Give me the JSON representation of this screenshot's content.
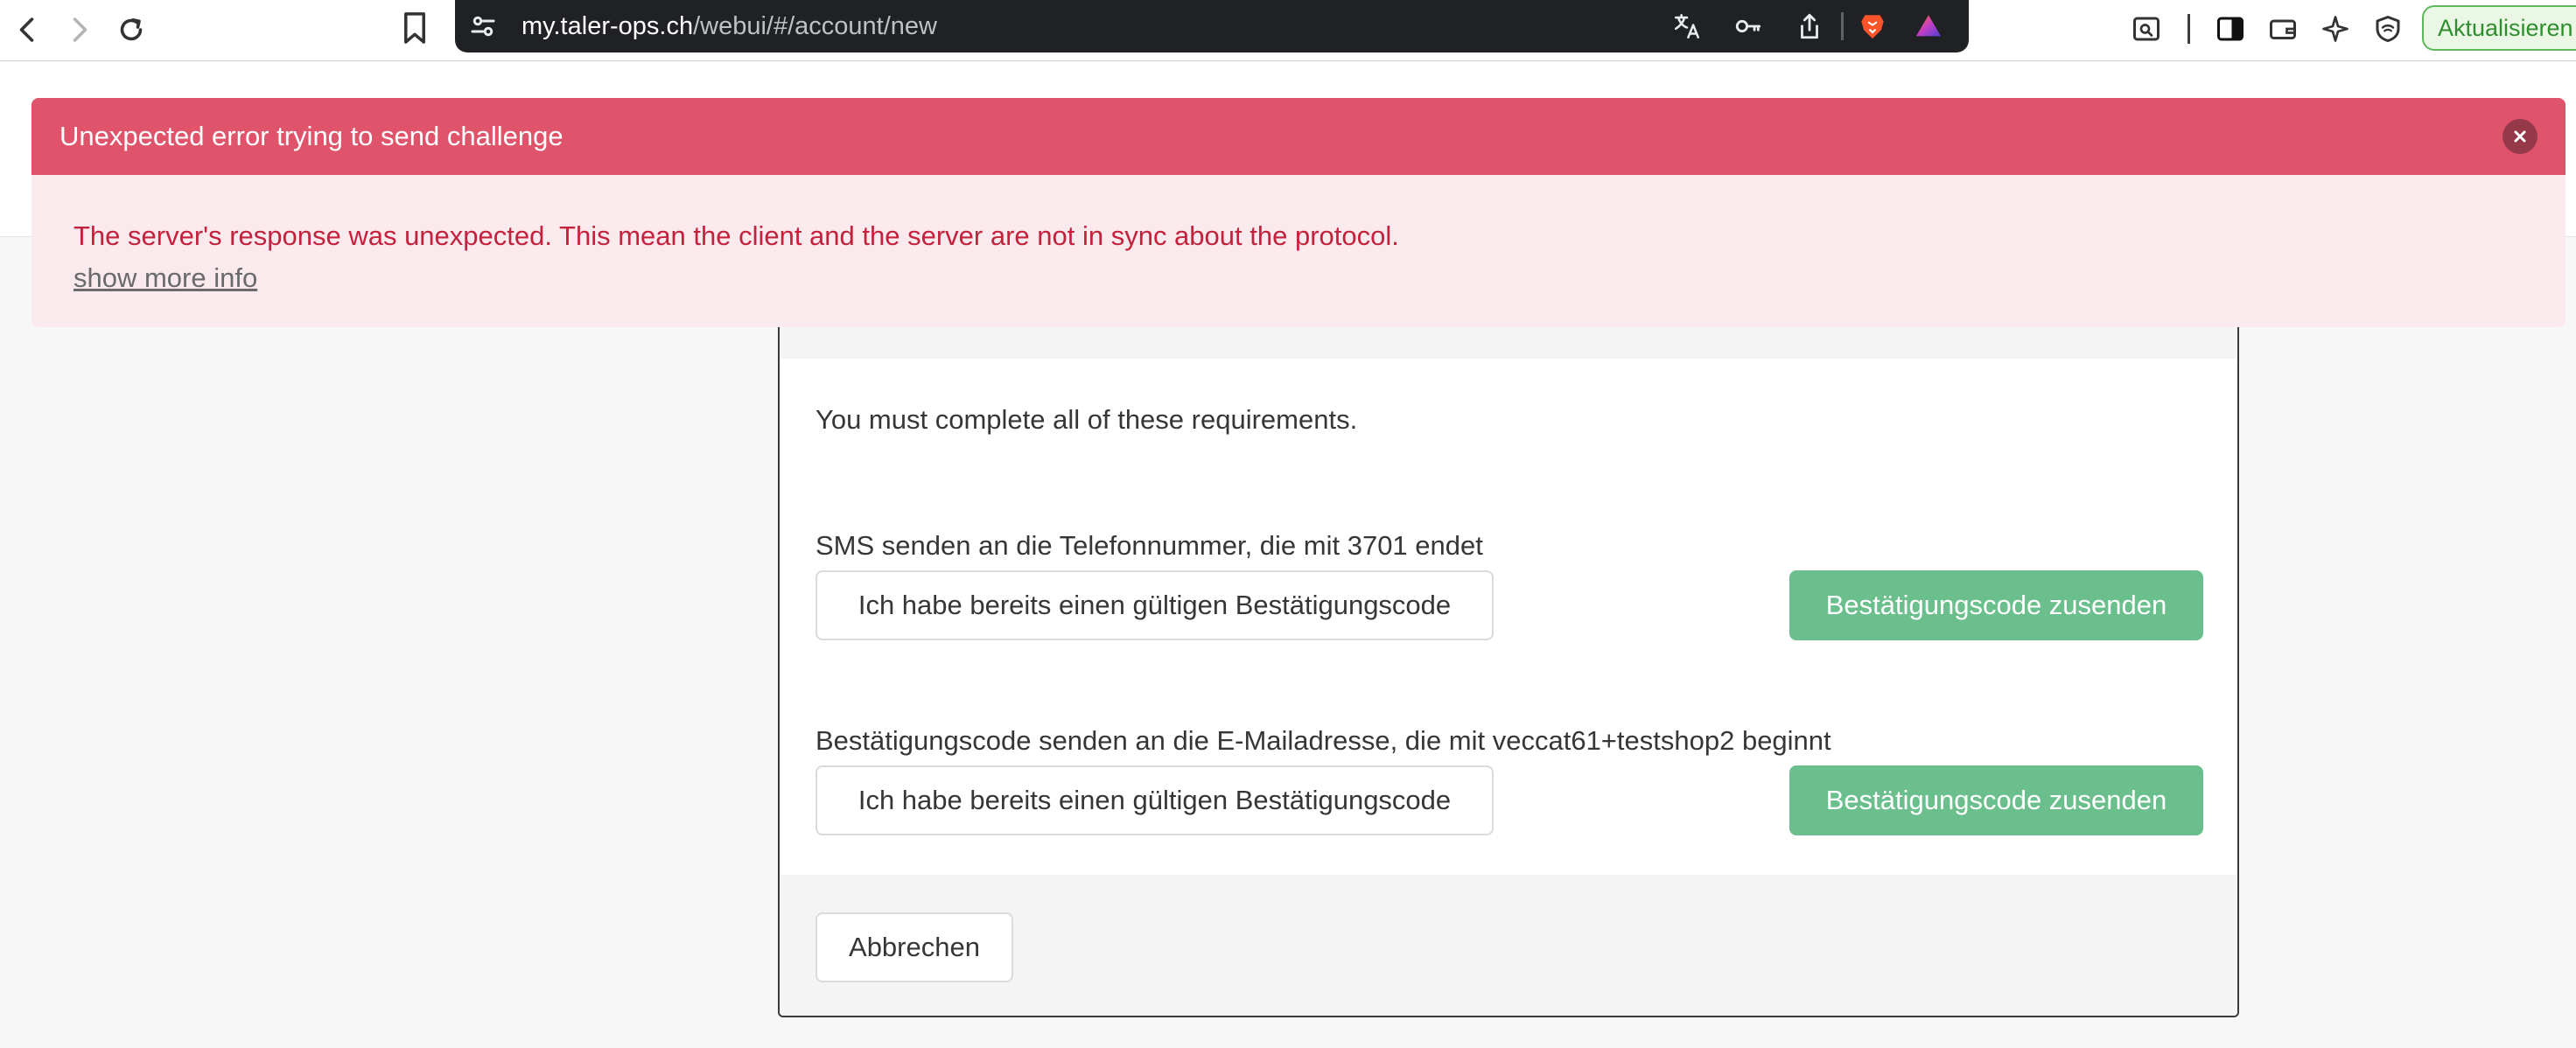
{
  "browser": {
    "url_host": "my.taler-ops.ch",
    "url_path": "/webui/#/account/new",
    "update_label": "Aktualisieren",
    "icons": {
      "back": "back-arrow-icon",
      "forward": "forward-arrow-icon",
      "reload": "reload-icon",
      "bookmark": "bookmark-icon",
      "site_settings": "tune-icon",
      "translate": "translate-icon",
      "password": "key-icon",
      "share": "share-icon",
      "brave_shields": "brave-lion-icon",
      "brave_rewards": "rewards-triangle-icon",
      "reader": "reader-mode-icon",
      "sidebar": "sidebar-icon",
      "wallet": "wallet-icon",
      "leo": "sparkle-icon",
      "vpn": "vpn-shield-icon"
    }
  },
  "notification": {
    "title": "Unexpected error trying to send challenge",
    "message": "The server's response was unexpected. This mean the client and the server are not in sync about the protocol.",
    "more_link": "show more info",
    "close_icon": "close-icon",
    "colors": {
      "header": "#e0546b",
      "body": "#fbeaed",
      "text": "#c4213d"
    }
  },
  "challenge": {
    "intro": "You must complete all of these requirements.",
    "requirements": [
      {
        "label": "SMS senden an die Telefonnummer, die mit 3701 endet",
        "have_code_label": "Ich habe bereits einen gültigen Bestätigungscode",
        "send_label": "Bestätigungscode zusenden"
      },
      {
        "label": "Bestätigungscode senden an die E-Mailadresse, die mit veccat61+testshop2 beginnt",
        "have_code_label": "Ich habe bereits einen gültigen Bestätigungscode",
        "send_label": "Bestätigungscode zusenden"
      }
    ],
    "cancel_label": "Abbrechen",
    "accent_color": "#6bbf8c"
  }
}
